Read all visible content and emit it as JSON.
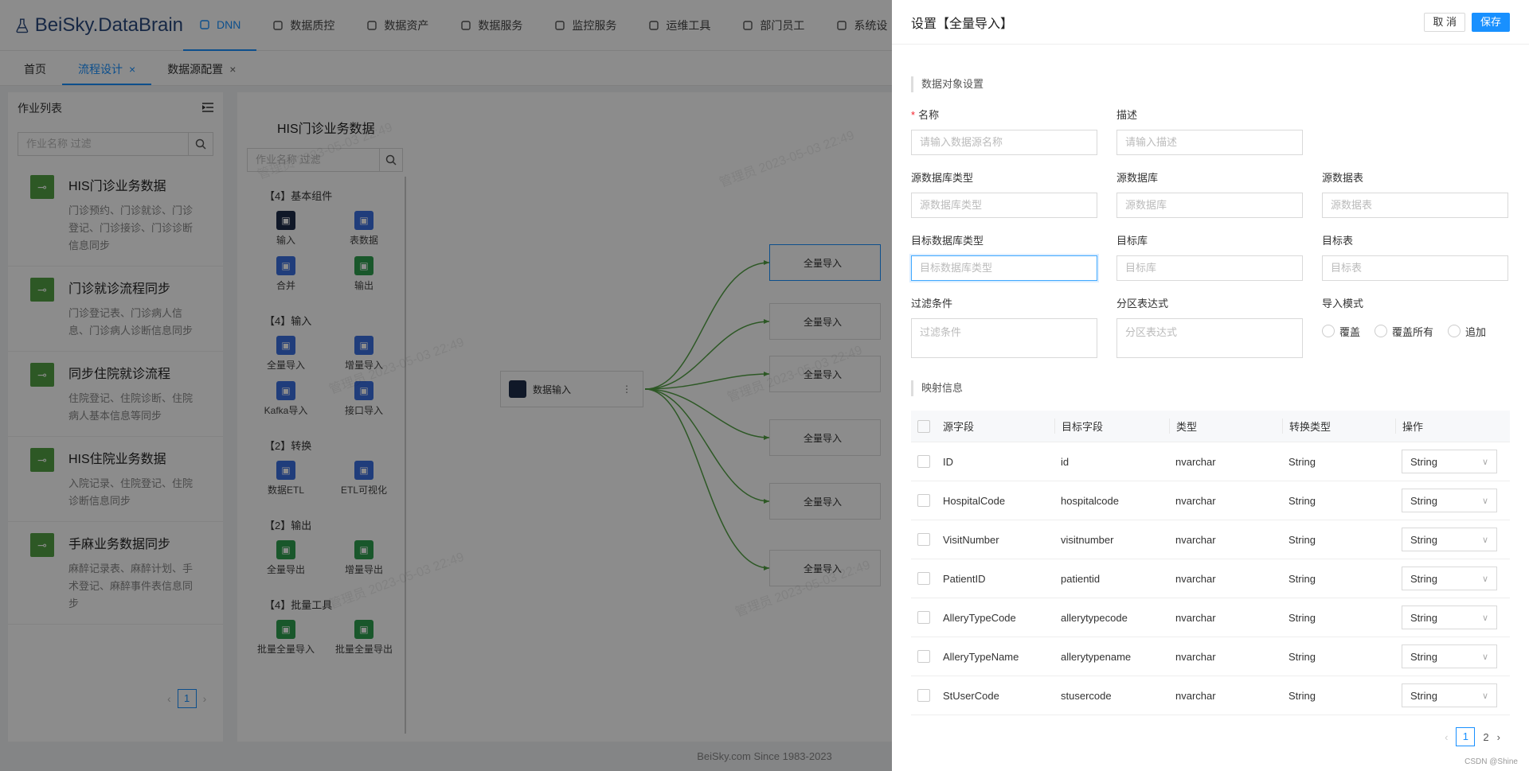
{
  "app": {
    "title": "BeiSky.DataBrain"
  },
  "nav": [
    {
      "label": "DNN",
      "icon": "share-icon",
      "active": true
    },
    {
      "label": "数据质控",
      "icon": "edit-icon"
    },
    {
      "label": "数据资产",
      "icon": "document-icon"
    },
    {
      "label": "数据服务",
      "icon": "swap-icon"
    },
    {
      "label": "监控服务",
      "icon": "bar-chart-icon"
    },
    {
      "label": "运维工具",
      "icon": "tool-icon"
    },
    {
      "label": "部门员工",
      "icon": "user-icon"
    },
    {
      "label": "系统设",
      "icon": "gear-icon"
    }
  ],
  "tabs": [
    {
      "label": "首页",
      "closable": false
    },
    {
      "label": "流程设计",
      "closable": true,
      "active": true
    },
    {
      "label": "数据源配置",
      "closable": true
    }
  ],
  "joblist": {
    "title": "作业列表",
    "search_placeholder": "作业名称 过滤",
    "items": [
      {
        "title": "HIS门诊业务数据",
        "desc": "门诊预约、门诊就诊、门诊登记、门诊接诊、门诊诊断信息同步"
      },
      {
        "title": "门诊就诊流程同步",
        "desc": "门诊登记表、门诊病人信息、门诊病人诊断信息同步"
      },
      {
        "title": "同步住院就诊流程",
        "desc": "住院登记、住院诊断、住院病人基本信息等同步"
      },
      {
        "title": "HIS住院业务数据",
        "desc": "入院记录、住院登记、住院诊断信息同步"
      },
      {
        "title": "手麻业务数据同步",
        "desc": "麻醉记录表、麻醉计划、手术登记、麻醉事件表信息同步"
      }
    ],
    "page": "1"
  },
  "flow": {
    "title": "HIS门诊业务数据",
    "search_placeholder": "作业名称 过滤",
    "palette": [
      {
        "group": "【4】基本组件",
        "items": [
          {
            "label": "输入",
            "color": "navy"
          },
          {
            "label": "表数据",
            "color": "blue"
          },
          {
            "label": "合并",
            "color": "blue"
          },
          {
            "label": "输出",
            "color": "green"
          }
        ]
      },
      {
        "group": "【4】输入",
        "items": [
          {
            "label": "全量导入",
            "color": "blue"
          },
          {
            "label": "增量导入",
            "color": "blue"
          },
          {
            "label": "Kafka导入",
            "color": "blue"
          },
          {
            "label": "接口导入",
            "color": "blue"
          }
        ]
      },
      {
        "group": "【2】转换",
        "items": [
          {
            "label": "数据ETL",
            "color": "blue"
          },
          {
            "label": "ETL可视化",
            "color": "blue"
          }
        ]
      },
      {
        "group": "【2】输出",
        "items": [
          {
            "label": "全量导出",
            "color": "green"
          },
          {
            "label": "增量导出",
            "color": "green"
          }
        ]
      },
      {
        "group": "【4】批量工具",
        "items": [
          {
            "label": "批量全量导入",
            "color": "green"
          },
          {
            "label": "批量全量导出",
            "color": "green"
          }
        ]
      }
    ],
    "source_node": "数据输入",
    "target_nodes": [
      "全量导入",
      "全量导入",
      "全量导入",
      "全量导入",
      "全量导入",
      "全量导入"
    ],
    "watermark": "管理员 2023-05-03 22:49"
  },
  "footer": "BeiSky.com Since 1983-2023",
  "drawer": {
    "title": "设置【全量导入】",
    "cancel": "取 消",
    "save": "保存",
    "section1": "数据对象设置",
    "fields": {
      "name": {
        "label": "名称",
        "placeholder": "请输入数据源名称"
      },
      "desc": {
        "label": "描述",
        "placeholder": "请输入描述"
      },
      "src_db_type": {
        "label": "源数据库类型",
        "placeholder": "源数据库类型"
      },
      "src_db": {
        "label": "源数据库",
        "placeholder": "源数据库"
      },
      "src_table": {
        "label": "源数据表",
        "placeholder": "源数据表"
      },
      "dst_db_type": {
        "label": "目标数据库类型",
        "placeholder": "目标数据库类型"
      },
      "dst_db": {
        "label": "目标库",
        "placeholder": "目标库"
      },
      "dst_table": {
        "label": "目标表",
        "placeholder": "目标表"
      },
      "filter": {
        "label": "过滤条件",
        "placeholder": "过滤条件"
      },
      "partition": {
        "label": "分区表达式",
        "placeholder": "分区表达式"
      },
      "mode": {
        "label": "导入模式",
        "options": [
          "覆盖",
          "覆盖所有",
          "追加"
        ]
      }
    },
    "section2": "映射信息",
    "table": {
      "headers": [
        "源字段",
        "目标字段",
        "类型",
        "转换类型",
        "操作"
      ],
      "rows": [
        {
          "src": "ID",
          "dst": "id",
          "type": "nvarchar",
          "conv": "String",
          "op": "String"
        },
        {
          "src": "HospitalCode",
          "dst": "hospitalcode",
          "type": "nvarchar",
          "conv": "String",
          "op": "String"
        },
        {
          "src": "VisitNumber",
          "dst": "visitnumber",
          "type": "nvarchar",
          "conv": "String",
          "op": "String"
        },
        {
          "src": "PatientID",
          "dst": "patientid",
          "type": "nvarchar",
          "conv": "String",
          "op": "String"
        },
        {
          "src": "AlleryTypeCode",
          "dst": "allerytypecode",
          "type": "nvarchar",
          "conv": "String",
          "op": "String"
        },
        {
          "src": "AlleryTypeName",
          "dst": "allerytypename",
          "type": "nvarchar",
          "conv": "String",
          "op": "String"
        },
        {
          "src": "StUserCode",
          "dst": "stusercode",
          "type": "nvarchar",
          "conv": "String",
          "op": "String"
        }
      ]
    },
    "pages": [
      "1",
      "2"
    ],
    "credit": "CSDN @Shine"
  }
}
